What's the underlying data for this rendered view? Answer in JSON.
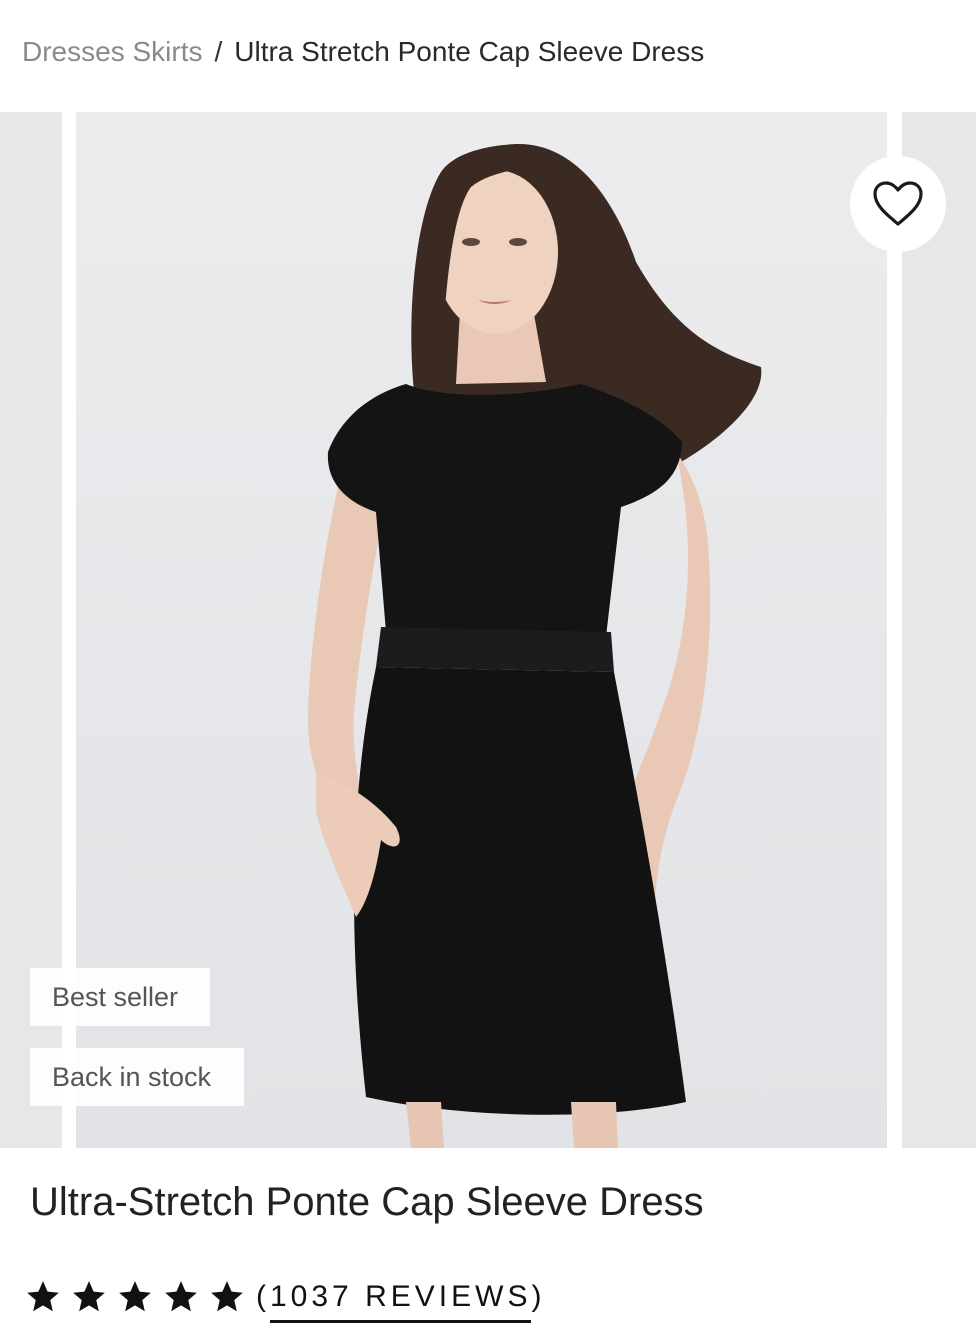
{
  "breadcrumb": {
    "parent": "Dresses Skirts",
    "separator": "/",
    "current": "Ultra Stretch Ponte Cap Sleeve Dress"
  },
  "gallery": {
    "wishlist_icon": "heart-outline-icon",
    "badges": [
      "Best seller",
      "Back in stock"
    ]
  },
  "product": {
    "title": "Ultra-Stretch Ponte Cap Sleeve Dress",
    "rating": 5,
    "rating_max": 5,
    "star_icon": "star-filled-icon",
    "review_count": "1037",
    "reviews_label": "REVIEWS"
  },
  "colors": {
    "background": "#ffffff",
    "text": "#222222",
    "muted": "#8a8a8a",
    "photo_bg": "#e7e7ea",
    "dress": "#111111"
  }
}
